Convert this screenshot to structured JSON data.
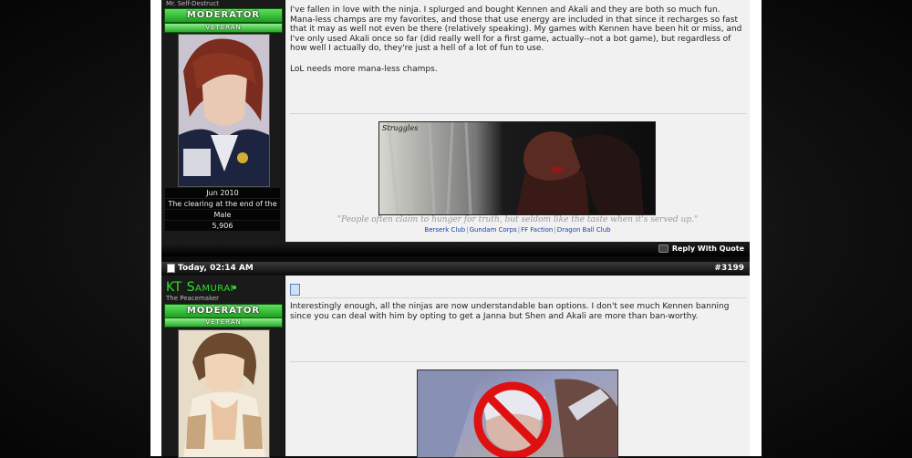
{
  "post1": {
    "user_title": "Mr. Self-Destruct",
    "rank_label": "MODERATOR",
    "rank_sub": "VETERAN",
    "join_date": "Jun 2010",
    "location": "The clearing at the end of the path",
    "gender": "Male",
    "post_count": "5,906",
    "text": "I've fallen in love with the ninja. I splurged and bought Kennen and Akali and they are both so much fun. Mana-less champs are my favorites, and those that use energy are included in that since it recharges so fast that it may as well not even be there (relatively speaking). My games with Kennen have been hit or miss, and I've only used Akali once so far (did really well for a first game, actually--not a bot game), but regardless of how well I actually do, they're just a hell of a lot of fun to use.",
    "text2": "LoL needs more mana-less champs.",
    "sig_banner_text": "Struggles",
    "sig_quote": "\"People often claim to hunger for truth, but seldom like the taste when it's served up.\"",
    "sig_links": [
      "Berserk Club",
      "Gundam Corps",
      "FF Faction",
      "Dragon Ball Club"
    ],
    "reply_label": "Reply With Quote"
  },
  "post2": {
    "date": "Today, 02:14 AM",
    "number": "#3199",
    "username": "KT Samurai",
    "user_title": "The Peacemaker",
    "rank_label": "MODERATOR",
    "rank_sub": "VETERAN",
    "text": "Interestingly enough, all the ninjas are now understandable ban options. I don't see much Kennen banning since you can deal with him by opting to get a Janna but Shen and Akali are more than ban-worthy."
  },
  "colors": {
    "accent_green": "#2ee02e",
    "link_blue": "#1a3ea8",
    "ban_red": "#e01010"
  }
}
